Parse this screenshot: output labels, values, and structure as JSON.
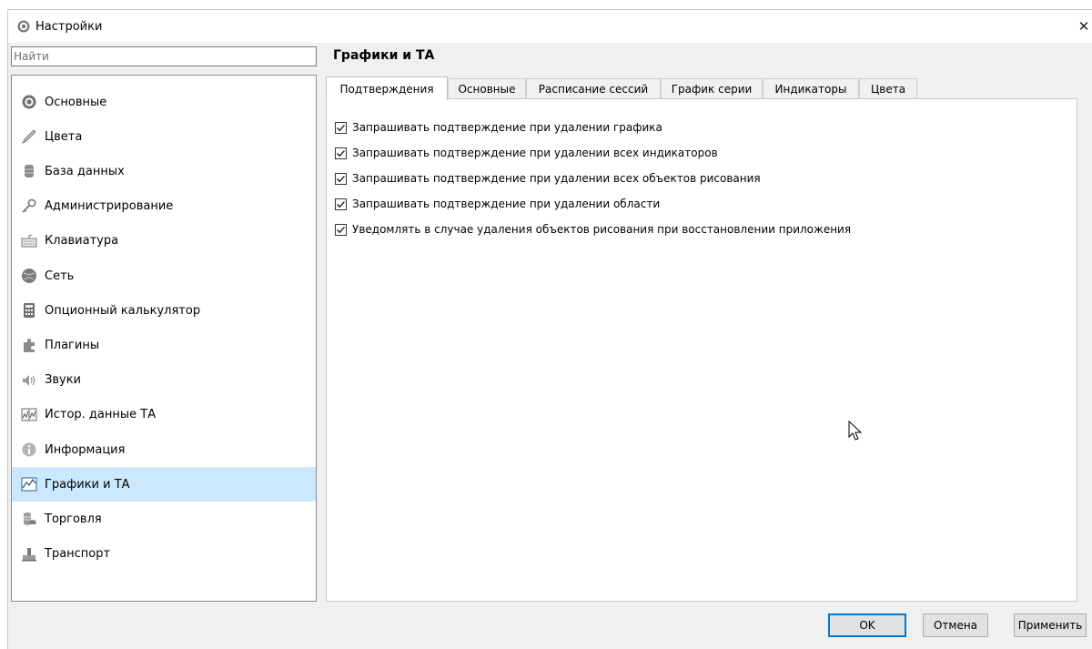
{
  "window": {
    "title": "Настройки",
    "close_glyph": "✕"
  },
  "search": {
    "placeholder": "Найти",
    "value": ""
  },
  "sidebar": {
    "items": [
      {
        "label": "Основные",
        "icon": "gear-icon"
      },
      {
        "label": "Цвета",
        "icon": "brush-icon"
      },
      {
        "label": "База данных",
        "icon": "database-icon"
      },
      {
        "label": "Администрирование",
        "icon": "key-icon"
      },
      {
        "label": "Клавиатура",
        "icon": "keyboard-icon"
      },
      {
        "label": "Сеть",
        "icon": "network-icon"
      },
      {
        "label": "Опционный калькулятор",
        "icon": "calculator-icon"
      },
      {
        "label": "Плагины",
        "icon": "puzzle-icon"
      },
      {
        "label": "Звуки",
        "icon": "speaker-icon"
      },
      {
        "label": "Истор. данные ТА",
        "icon": "history-chart-icon"
      },
      {
        "label": "Информация",
        "icon": "info-icon"
      },
      {
        "label": "Графики и ТА",
        "icon": "chart-icon"
      },
      {
        "label": "Торговля",
        "icon": "coins-icon"
      },
      {
        "label": "Транспорт",
        "icon": "transport-icon"
      }
    ],
    "selected_index": 11
  },
  "main": {
    "title": "Графики и ТА",
    "tabs": [
      {
        "label": "Подтверждения"
      },
      {
        "label": "Основные"
      },
      {
        "label": "Расписание сессий"
      },
      {
        "label": "График серии"
      },
      {
        "label": "Индикаторы"
      },
      {
        "label": "Цвета"
      }
    ],
    "active_tab": 0,
    "checkboxes": [
      {
        "label": "Запрашивать подтверждение при удалении графика",
        "checked": true
      },
      {
        "label": "Запрашивать подтверждение при удалении всех индикаторов",
        "checked": true
      },
      {
        "label": "Запрашивать подтверждение при удалении всех объектов рисования",
        "checked": true
      },
      {
        "label": "Запрашивать подтверждение при удалении области",
        "checked": true
      },
      {
        "label": "Уведомлять в случае удаления объектов рисования при восстановлении приложения",
        "checked": true
      }
    ]
  },
  "footer": {
    "ok_label": "OK",
    "cancel_label": "Отмена",
    "apply_label": "Применить"
  },
  "colors": {
    "selection": "#cce8ff",
    "default_button_border": "#0078d7",
    "window_bg": "#f0f0f0"
  }
}
